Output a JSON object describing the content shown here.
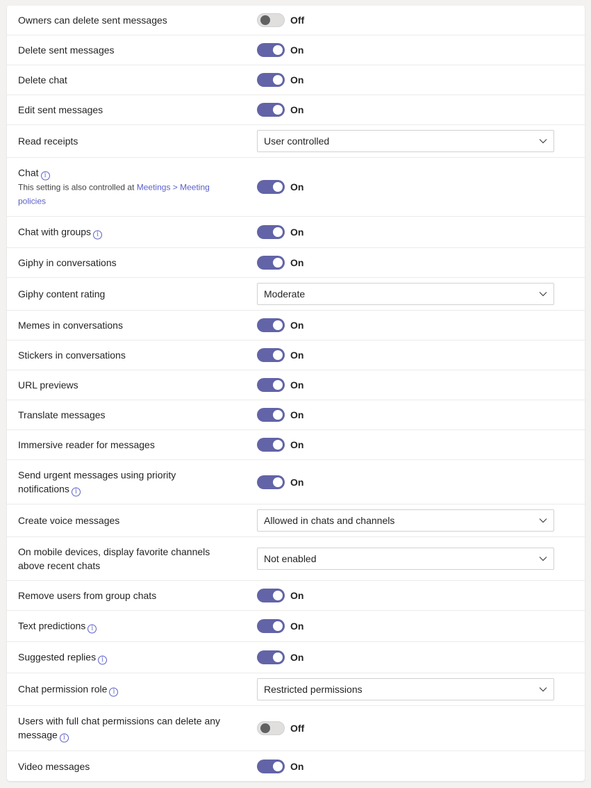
{
  "settings": [
    {
      "label": "Owners can delete sent messages",
      "type": "toggle",
      "on": false,
      "state": "Off"
    },
    {
      "label": "Delete sent messages",
      "type": "toggle",
      "on": true,
      "state": "On"
    },
    {
      "label": "Delete chat",
      "type": "toggle",
      "on": true,
      "state": "On"
    },
    {
      "label": "Edit sent messages",
      "type": "toggle",
      "on": true,
      "state": "On"
    },
    {
      "label": "Read receipts",
      "type": "select",
      "value": "User controlled"
    },
    {
      "label": "Chat",
      "info": true,
      "note": "This setting is also controlled at ",
      "note_link": "Meetings > Meeting policies",
      "type": "toggle",
      "on": true,
      "state": "On"
    },
    {
      "label": "Chat with groups",
      "info": true,
      "type": "toggle",
      "on": true,
      "state": "On"
    },
    {
      "label": "Giphy in conversations",
      "type": "toggle",
      "on": true,
      "state": "On"
    },
    {
      "label": "Giphy content rating",
      "type": "select",
      "value": "Moderate"
    },
    {
      "label": "Memes in conversations",
      "type": "toggle",
      "on": true,
      "state": "On"
    },
    {
      "label": "Stickers in conversations",
      "type": "toggle",
      "on": true,
      "state": "On"
    },
    {
      "label": "URL previews",
      "type": "toggle",
      "on": true,
      "state": "On"
    },
    {
      "label": "Translate messages",
      "type": "toggle",
      "on": true,
      "state": "On"
    },
    {
      "label": "Immersive reader for messages",
      "type": "toggle",
      "on": true,
      "state": "On"
    },
    {
      "label": "Send urgent messages using priority notifications",
      "info": true,
      "type": "toggle",
      "on": true,
      "state": "On"
    },
    {
      "label": "Create voice messages",
      "type": "select",
      "value": "Allowed in chats and channels"
    },
    {
      "label": "On mobile devices, display favorite channels above recent chats",
      "type": "select",
      "value": "Not enabled"
    },
    {
      "label": "Remove users from group chats",
      "type": "toggle",
      "on": true,
      "state": "On"
    },
    {
      "label": "Text predictions",
      "info": true,
      "type": "toggle",
      "on": true,
      "state": "On"
    },
    {
      "label": "Suggested replies",
      "info": true,
      "type": "toggle",
      "on": true,
      "state": "On"
    },
    {
      "label": "Chat permission role",
      "info": true,
      "type": "select",
      "value": "Restricted permissions"
    },
    {
      "label": "Users with full chat permissions can delete any message",
      "info": true,
      "type": "toggle",
      "on": false,
      "state": "Off"
    },
    {
      "label": "Video messages",
      "type": "toggle",
      "on": true,
      "state": "On"
    }
  ],
  "colors": {
    "toggle_on": "#6264a7",
    "toggle_off": "#e1dfdd",
    "link": "#5b5fc7",
    "background": "#f3f2f1"
  },
  "icons": {
    "info": "info-icon",
    "dropdown": "chevron-down-icon"
  }
}
